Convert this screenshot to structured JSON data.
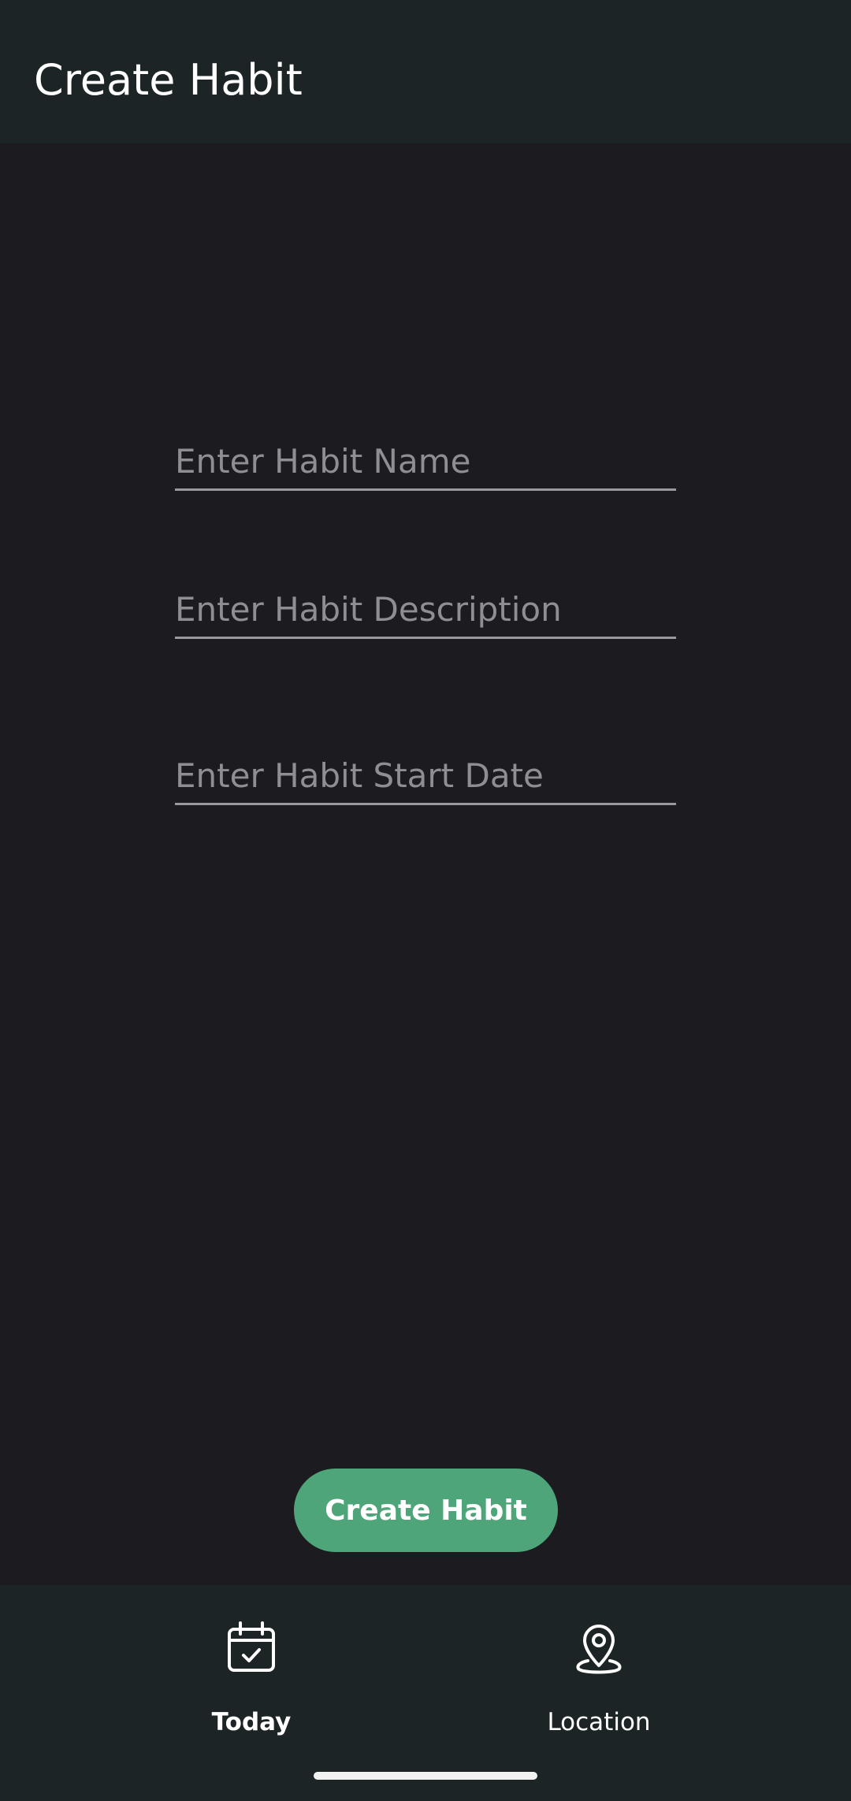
{
  "app_bar": {
    "title": "Create Habit"
  },
  "form": {
    "habit_name_placeholder": "Enter Habit Name",
    "habit_description_placeholder": "Enter Habit Description",
    "habit_start_date_placeholder": "Enter Habit Start Date",
    "submit_label": "Create Habit"
  },
  "bottom_nav": {
    "items": [
      {
        "label": "Today",
        "icon": "calendar-check-icon",
        "selected": true
      },
      {
        "label": "Location",
        "icon": "map-pin-icon",
        "selected": false
      }
    ]
  },
  "colors": {
    "background": "#1c1c20",
    "app_bar": "#1d2426",
    "accent": "#4ea579",
    "placeholder": "#8e8e93"
  }
}
